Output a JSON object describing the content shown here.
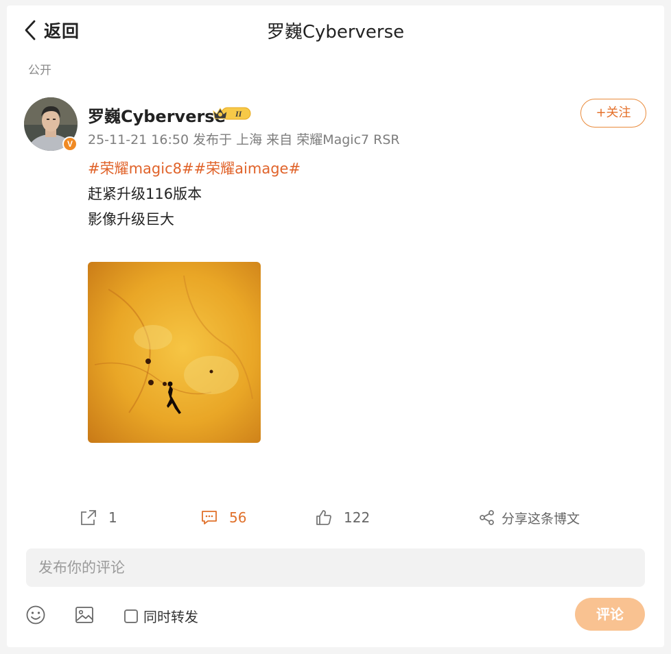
{
  "header": {
    "back_label": "返回",
    "title": "罗巍Cyberverse"
  },
  "post": {
    "visibility": "公开",
    "author": {
      "name": "罗巍Cyberverse",
      "verified_badge": "V",
      "rank_badge": "II"
    },
    "follow_label": "+关注",
    "meta": "25-11-21 16:50 发布于 上海 来自 荣耀Magic7 RSR",
    "tags": "#荣耀magic8##荣耀aimage#",
    "lines": [
      "赶紧升级116版本",
      "影像升级巨大"
    ]
  },
  "actions": {
    "repost_count": "1",
    "comment_count": "56",
    "like_count": "122",
    "share_label": "分享这条博文"
  },
  "composer": {
    "placeholder": "发布你的评论",
    "repost_label": "同时转发",
    "submit_label": "评论"
  },
  "colors": {
    "accent": "#e0632a",
    "submit_bg": "#f9c291",
    "badge_orange": "#f08a24"
  }
}
